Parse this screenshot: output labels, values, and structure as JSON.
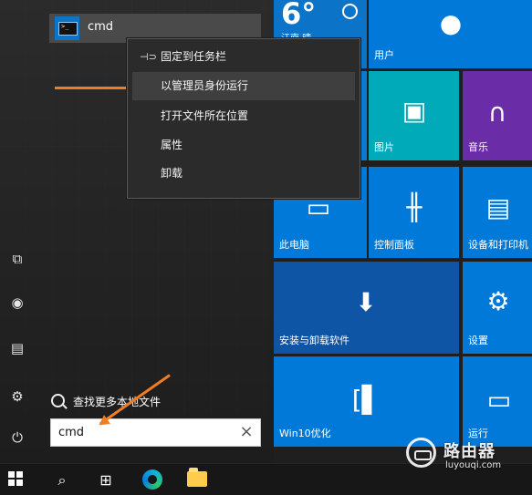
{
  "search_result": {
    "app_name": "cmd"
  },
  "context_menu": {
    "items": [
      {
        "label": "固定到任务栏",
        "icon": "pin-icon"
      },
      {
        "label": "以管理员身份运行"
      },
      {
        "label": "打开文件所在位置"
      },
      {
        "label": "属性"
      },
      {
        "label": "卸载"
      }
    ]
  },
  "search": {
    "more_files_label": "查找更多本地文件",
    "value": "cmd"
  },
  "tiles": {
    "weather": {
      "temperature": "6°",
      "location": "江南 晴"
    },
    "items": [
      {
        "label": "用户",
        "icon": "user-icon"
      },
      {
        "label": "图片",
        "icon": "image-icon"
      },
      {
        "label": "音乐",
        "icon": "headphones-icon"
      },
      {
        "label": "此电脑",
        "icon": "monitor-icon"
      },
      {
        "label": "控制面板",
        "icon": "control-panel-icon"
      },
      {
        "label": "设备和打印机",
        "icon": "printer-icon"
      },
      {
        "label": "安装与卸载软件",
        "icon": "download-box-icon"
      },
      {
        "label": "设置",
        "icon": "gear-icon"
      },
      {
        "label": "Win10优化",
        "icon": "optimize-icon"
      },
      {
        "label": "运行",
        "icon": "run-icon"
      }
    ]
  },
  "watermark": {
    "title": "路由器",
    "subtitle": "luyouqi.com"
  },
  "colors": {
    "tile_blue": "#0079d8",
    "tile_cyan": "#00aab8",
    "tile_purple": "#6b2ca8",
    "arrow_orange": "#ef7d22"
  }
}
